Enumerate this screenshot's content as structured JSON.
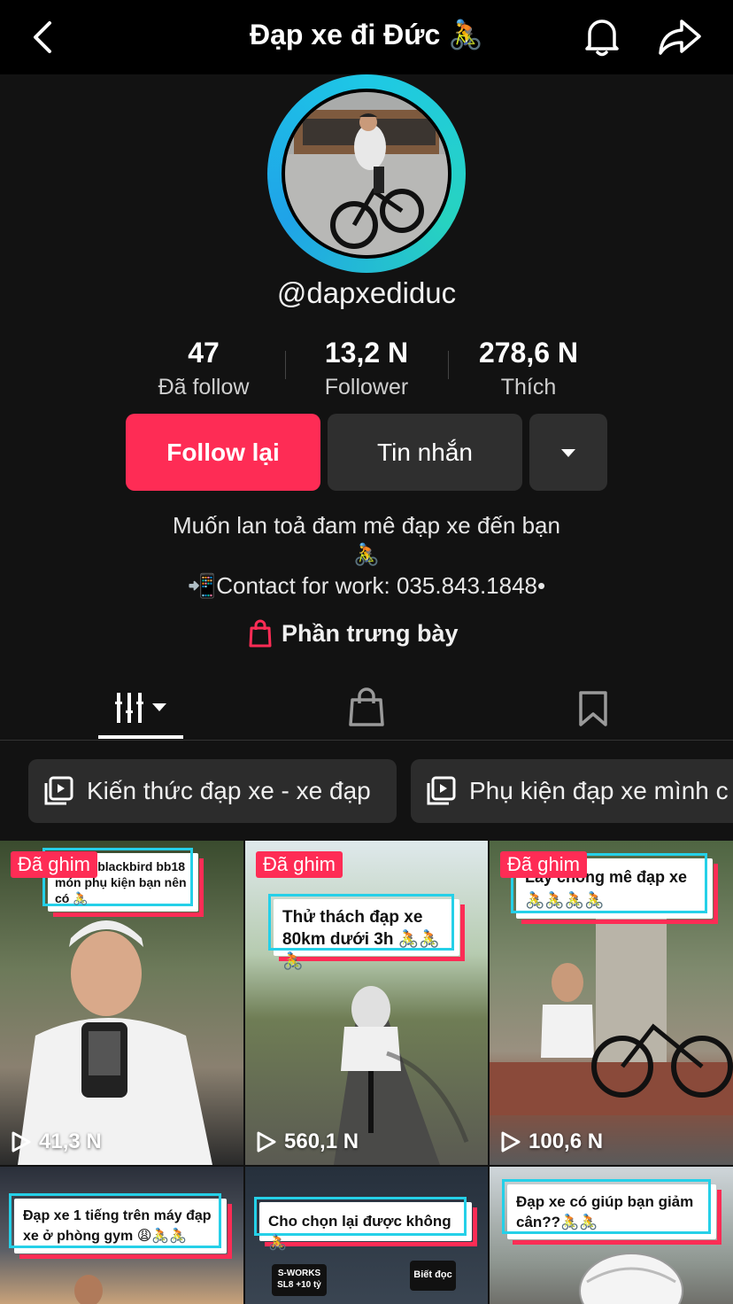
{
  "header": {
    "title": "Đạp xe đi Đức 🚴"
  },
  "profile": {
    "handle": "@dapxediduc",
    "stats": [
      {
        "value": "47",
        "label": "Đã follow"
      },
      {
        "value": "13,2 N",
        "label": "Follower"
      },
      {
        "value": "278,6 N",
        "label": "Thích"
      }
    ],
    "buttons": {
      "follow": "Follow lại",
      "message": "Tin nhắn"
    },
    "bio_line1": "Muốn lan toả đam mê đạp xe đến bạn",
    "bio_line2": "🚴",
    "bio_line3": "📲Contact for work: 035.843.1848•",
    "showcase_label": "Phần trưng bày"
  },
  "playlists": [
    {
      "label": "Kiến thức đạp xe - xe đạp"
    },
    {
      "label": "Phụ kiện đạp xe mình c"
    }
  ],
  "videos": [
    {
      "pinned": "Đã ghim",
      "caption": "đạp xe blackbird bb18 món phụ kiện bạn nên có 🚴",
      "views": "41,3 N"
    },
    {
      "pinned": "Đã ghim",
      "caption": "Thử thách đạp xe 80km dưới 3h 🚴🚴🚴",
      "views": "560,1 N"
    },
    {
      "pinned": "Đã ghim",
      "caption": "Lấy chồng mê đạp xe 🚴🚴🚴🚴",
      "views": "100,6 N"
    },
    {
      "caption": "Đạp xe 1 tiếng trên máy đạp xe ở phòng gym 😩🚴🚴"
    },
    {
      "caption": "Cho chọn lại được không🚴",
      "sticker1": "S-WORKS SL8 +10 tỷ",
      "sticker2": "Biết đọc"
    },
    {
      "caption": "Đạp xe có giúp bạn giảm cân??🚴🚴"
    }
  ],
  "colors": {
    "accent": "#fe2c55",
    "ring": "#1ec8e6",
    "background": "#121212"
  }
}
